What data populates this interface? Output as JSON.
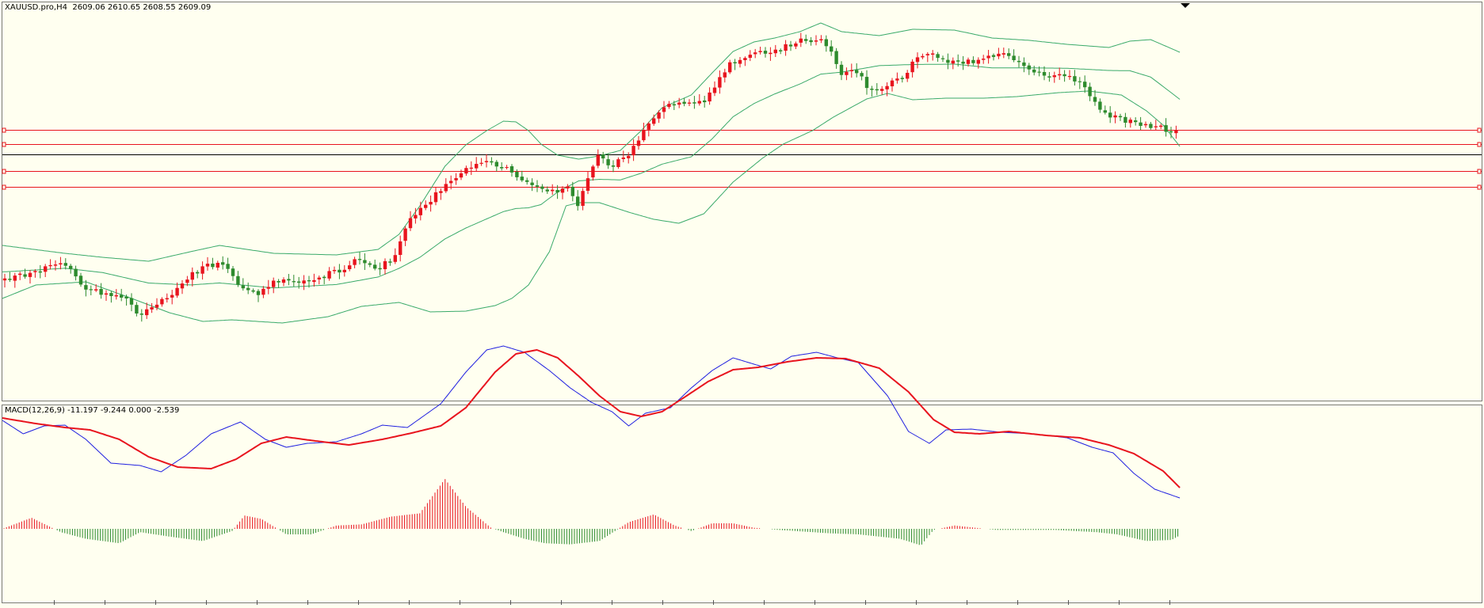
{
  "price_panel": {
    "label": "XAUUSD.pro,H4  2609.06 2610.65 2608.55 2609.09"
  },
  "macd_panel": {
    "label": "MACD(12,26,9) -11.197 -9.244 0.000 -2.539"
  },
  "colors": {
    "background": "#fffff0",
    "bull_candle": "#e8141e",
    "bear_candle": "#2e8b2e",
    "bollinger": "#3aaa6a",
    "level_lines": "#e8141e",
    "current_price_line": "#000000",
    "macd_line": "#1f1fe0",
    "signal_line": "#e8141e",
    "histogram_positive": "#e8141e",
    "histogram_negative": "#2e8b2e"
  },
  "chart_data": [
    {
      "type": "candlestick",
      "symbol": "XAUUSD.pro",
      "timeframe": "H4",
      "last_bar": {
        "open": 2609.06,
        "high": 2610.65,
        "low": 2608.55,
        "close": 2609.09
      },
      "indicators": [
        "Bollinger Bands"
      ],
      "bar_count": 230,
      "horizontal_level_lines": 4,
      "close_path_anchors": [
        [
          0,
          354
        ],
        [
          10,
          348
        ],
        [
          20,
          338
        ],
        [
          30,
          333
        ],
        [
          40,
          365
        ],
        [
          50,
          372
        ],
        [
          60,
          378
        ],
        [
          66,
          398
        ],
        [
          72,
          384
        ],
        [
          80,
          375
        ],
        [
          86,
          360
        ],
        [
          90,
          345
        ],
        [
          100,
          335
        ],
        [
          106,
          332
        ],
        [
          114,
          366
        ],
        [
          122,
          374
        ],
        [
          130,
          357
        ],
        [
          140,
          356
        ],
        [
          150,
          350
        ],
        [
          160,
          344
        ],
        [
          166,
          335
        ],
        [
          172,
          327
        ],
        [
          180,
          338
        ],
        [
          186,
          330
        ],
        [
          190,
          310
        ],
        [
          196,
          272
        ],
        [
          202,
          258
        ],
        [
          212,
          236
        ],
        [
          222,
          214
        ],
        [
          232,
          205
        ],
        [
          240,
          212
        ],
        [
          246,
          220
        ],
        [
          252,
          228
        ],
        [
          260,
          238
        ],
        [
          266,
          240
        ],
        [
          272,
          236
        ],
        [
          276,
          265
        ],
        [
          280,
          226
        ],
        [
          286,
          195
        ],
        [
          292,
          210
        ],
        [
          298,
          200
        ],
        [
          304,
          180
        ],
        [
          310,
          152
        ],
        [
          318,
          135
        ],
        [
          325,
          129
        ],
        [
          332,
          130
        ],
        [
          336,
          128
        ],
        [
          340,
          115
        ],
        [
          346,
          88
        ],
        [
          352,
          74
        ],
        [
          360,
          70
        ],
        [
          368,
          68
        ],
        [
          376,
          58
        ],
        [
          384,
          50
        ],
        [
          390,
          52
        ],
        [
          396,
          60
        ],
        [
          402,
          95
        ],
        [
          408,
          86
        ],
        [
          414,
          110
        ],
        [
          420,
          112
        ],
        [
          430,
          100
        ],
        [
          440,
          68
        ],
        [
          448,
          72
        ],
        [
          456,
          80
        ],
        [
          466,
          76
        ],
        [
          474,
          74
        ],
        [
          482,
          68
        ],
        [
          488,
          82
        ],
        [
          496,
          92
        ],
        [
          504,
          95
        ],
        [
          512,
          98
        ],
        [
          518,
          110
        ],
        [
          522,
          128
        ],
        [
          526,
          140
        ],
        [
          532,
          148
        ],
        [
          538,
          152
        ],
        [
          544,
          157
        ],
        [
          548,
          160
        ],
        [
          552,
          162
        ],
        [
          556,
          164
        ],
        [
          560,
          166
        ],
        [
          564,
          165
        ]
      ],
      "bollinger_upper_anchors": [
        [
          0,
          310
        ],
        [
          30,
          320
        ],
        [
          48,
          325
        ],
        [
          70,
          330
        ],
        [
          90,
          318
        ],
        [
          104,
          310
        ],
        [
          130,
          320
        ],
        [
          160,
          322
        ],
        [
          180,
          315
        ],
        [
          190,
          296
        ],
        [
          200,
          260
        ],
        [
          212,
          210
        ],
        [
          222,
          183
        ],
        [
          232,
          165
        ],
        [
          240,
          153
        ],
        [
          246,
          154
        ],
        [
          252,
          165
        ],
        [
          258,
          182
        ],
        [
          266,
          196
        ],
        [
          276,
          201
        ],
        [
          286,
          197
        ],
        [
          296,
          190
        ],
        [
          306,
          165
        ],
        [
          316,
          136
        ],
        [
          330,
          120
        ],
        [
          340,
          92
        ],
        [
          350,
          65
        ],
        [
          360,
          53
        ],
        [
          370,
          48
        ],
        [
          382,
          40
        ],
        [
          392,
          29
        ],
        [
          402,
          40
        ],
        [
          420,
          45
        ],
        [
          436,
          37
        ],
        [
          456,
          38
        ],
        [
          474,
          48
        ],
        [
          492,
          51
        ],
        [
          510,
          56
        ],
        [
          530,
          60
        ],
        [
          540,
          52
        ],
        [
          550,
          50
        ],
        [
          564,
          66
        ]
      ],
      "bollinger_lower_anchors": [
        [
          0,
          377
        ],
        [
          16,
          360
        ],
        [
          40,
          356
        ],
        [
          60,
          375
        ],
        [
          80,
          395
        ],
        [
          96,
          406
        ],
        [
          110,
          404
        ],
        [
          134,
          408
        ],
        [
          156,
          400
        ],
        [
          172,
          387
        ],
        [
          190,
          382
        ],
        [
          205,
          394
        ],
        [
          222,
          393
        ],
        [
          236,
          386
        ],
        [
          244,
          377
        ],
        [
          252,
          360
        ],
        [
          262,
          318
        ],
        [
          270,
          260
        ],
        [
          276,
          256
        ],
        [
          286,
          256
        ],
        [
          300,
          268
        ],
        [
          312,
          277
        ],
        [
          324,
          282
        ],
        [
          336,
          270
        ],
        [
          350,
          230
        ],
        [
          364,
          200
        ],
        [
          374,
          182
        ],
        [
          388,
          165
        ],
        [
          398,
          148
        ],
        [
          414,
          125
        ],
        [
          424,
          118
        ],
        [
          436,
          126
        ],
        [
          452,
          124
        ],
        [
          470,
          124
        ],
        [
          486,
          122
        ],
        [
          506,
          117
        ],
        [
          520,
          115
        ],
        [
          530,
          118
        ],
        [
          536,
          120
        ],
        [
          548,
          140
        ],
        [
          556,
          158
        ],
        [
          564,
          185
        ]
      ]
    },
    {
      "type": "line",
      "indicator": "MACD(12,26,9)",
      "values": {
        "macd": -11.197,
        "signal": -9.244,
        "level": 0.0,
        "histogram": -2.539
      },
      "series": [
        {
          "name": "MACD",
          "anchors": [
            [
              0,
              531
            ],
            [
              10,
              548
            ],
            [
              20,
              538
            ],
            [
              30,
              537
            ],
            [
              40,
              555
            ],
            [
              52,
              585
            ],
            [
              66,
              588
            ],
            [
              76,
              596
            ],
            [
              88,
              575
            ],
            [
              100,
              548
            ],
            [
              114,
              533
            ],
            [
              126,
              555
            ],
            [
              136,
              565
            ],
            [
              146,
              560
            ],
            [
              160,
              558
            ],
            [
              172,
              548
            ],
            [
              182,
              537
            ],
            [
              194,
              540
            ],
            [
              210,
              510
            ],
            [
              222,
              470
            ],
            [
              232,
              442
            ],
            [
              240,
              437
            ],
            [
              250,
              445
            ],
            [
              262,
              468
            ],
            [
              272,
              490
            ],
            [
              282,
              508
            ],
            [
              292,
              520
            ],
            [
              300,
              538
            ],
            [
              308,
              522
            ],
            [
              320,
              515
            ],
            [
              330,
              490
            ],
            [
              340,
              468
            ],
            [
              350,
              452
            ],
            [
              360,
              460
            ],
            [
              368,
              466
            ],
            [
              378,
              450
            ],
            [
              390,
              445
            ],
            [
              400,
              452
            ],
            [
              410,
              458
            ],
            [
              424,
              500
            ],
            [
              434,
              545
            ],
            [
              444,
              560
            ],
            [
              452,
              543
            ],
            [
              464,
              542
            ],
            [
              478,
              546
            ],
            [
              494,
              548
            ],
            [
              510,
              553
            ],
            [
              522,
              565
            ],
            [
              532,
              572
            ],
            [
              542,
              598
            ],
            [
              552,
              618
            ],
            [
              564,
              629
            ]
          ]
        },
        {
          "name": "Signal",
          "anchors": [
            [
              0,
              528
            ],
            [
              16,
              535
            ],
            [
              30,
              540
            ],
            [
              42,
              543
            ],
            [
              56,
              555
            ],
            [
              70,
              577
            ],
            [
              84,
              590
            ],
            [
              100,
              592
            ],
            [
              112,
              580
            ],
            [
              124,
              560
            ],
            [
              136,
              552
            ],
            [
              150,
              557
            ],
            [
              166,
              562
            ],
            [
              182,
              555
            ],
            [
              196,
              547
            ],
            [
              210,
              538
            ],
            [
              222,
              515
            ],
            [
              236,
              470
            ],
            [
              246,
              447
            ],
            [
              256,
              442
            ],
            [
              266,
              452
            ],
            [
              276,
              475
            ],
            [
              286,
              500
            ],
            [
              296,
              520
            ],
            [
              306,
              526
            ],
            [
              316,
              520
            ],
            [
              326,
              503
            ],
            [
              338,
              482
            ],
            [
              350,
              467
            ],
            [
              362,
              464
            ],
            [
              376,
              457
            ],
            [
              390,
              452
            ],
            [
              404,
              453
            ],
            [
              420,
              465
            ],
            [
              434,
              495
            ],
            [
              446,
              530
            ],
            [
              456,
              546
            ],
            [
              468,
              548
            ],
            [
              482,
              545
            ],
            [
              500,
              550
            ],
            [
              516,
              553
            ],
            [
              530,
              562
            ],
            [
              542,
              573
            ],
            [
              556,
              595
            ],
            [
              564,
              616
            ]
          ]
        }
      ],
      "histogram_anchors": [
        [
          0,
          0.0
        ],
        [
          14,
          1.0
        ],
        [
          28,
          -0.3
        ],
        [
          40,
          -0.9
        ],
        [
          56,
          -1.3
        ],
        [
          66,
          -0.3
        ],
        [
          80,
          -0.7
        ],
        [
          96,
          -1.1
        ],
        [
          110,
          -0.2
        ],
        [
          116,
          1.2
        ],
        [
          124,
          0.9
        ],
        [
          136,
          -0.5
        ],
        [
          148,
          -0.5
        ],
        [
          160,
          0.3
        ],
        [
          172,
          0.4
        ],
        [
          186,
          1.1
        ],
        [
          200,
          1.4
        ],
        [
          212,
          4.5
        ],
        [
          222,
          2.0
        ],
        [
          234,
          0.1
        ],
        [
          240,
          -0.3
        ],
        [
          250,
          -0.9
        ],
        [
          260,
          -1.3
        ],
        [
          272,
          -1.4
        ],
        [
          286,
          -1.1
        ],
        [
          300,
          0.6
        ],
        [
          312,
          1.3
        ],
        [
          322,
          0.3
        ],
        [
          330,
          -0.2
        ],
        [
          340,
          0.5
        ],
        [
          350,
          0.5
        ],
        [
          360,
          0.1
        ],
        [
          372,
          -0.1
        ],
        [
          380,
          -0.2
        ],
        [
          396,
          -0.4
        ],
        [
          410,
          -0.5
        ],
        [
          430,
          -0.9
        ],
        [
          440,
          -1.5
        ],
        [
          446,
          -0.1
        ],
        [
          456,
          0.3
        ],
        [
          466,
          0.1
        ],
        [
          476,
          -0.1
        ],
        [
          490,
          -0.1
        ],
        [
          504,
          -0.1
        ],
        [
          514,
          -0.2
        ],
        [
          524,
          -0.3
        ],
        [
          534,
          -0.5
        ],
        [
          548,
          -1.1
        ],
        [
          560,
          -1.0
        ],
        [
          564,
          -0.6
        ]
      ]
    }
  ]
}
